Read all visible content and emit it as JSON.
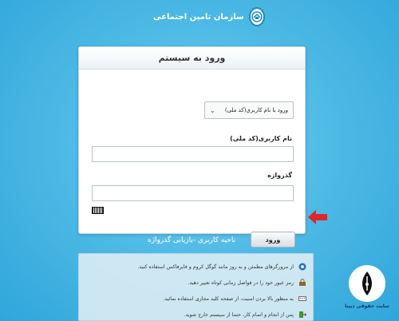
{
  "brand": {
    "org_name": "سازمان تامین اجتماعی"
  },
  "login": {
    "title": "ورود به سیستم",
    "login_type_selected": "ورود با نام کاربری(کد ملی)",
    "username_label": "نام کاربری(کد ملی)",
    "username_value": "",
    "password_label": "گذرواژه",
    "password_value": "",
    "submit_label": "ورود"
  },
  "forgot_link": "ناحیه کاربری -بازیابی گذرواژه",
  "info": {
    "items": [
      {
        "icon": "browser-icon",
        "text": "از مرورگرهای مطمئن و به روز مانند گوگل کروم و فایرفاکس استفاده کنید."
      },
      {
        "icon": "password-icon",
        "text": "رمز عبور خود را در فواصل زمانی کوتاه تغییر دهید."
      },
      {
        "icon": "keyboard-icon",
        "text": "به منظور بالا بردن امنیت، از صفحه کلید مجازی استفاده نمائید."
      },
      {
        "icon": "exit-icon",
        "text": "پس از انجام و اتمام کار، حتما از سیستم خارج شوید."
      }
    ]
  },
  "watermark": {
    "text": "سایت حقوقی دیپنا"
  },
  "colors": {
    "background": "#4fbbe6",
    "arrow": "#e0262b",
    "brand_blue": "#1f88c2"
  }
}
